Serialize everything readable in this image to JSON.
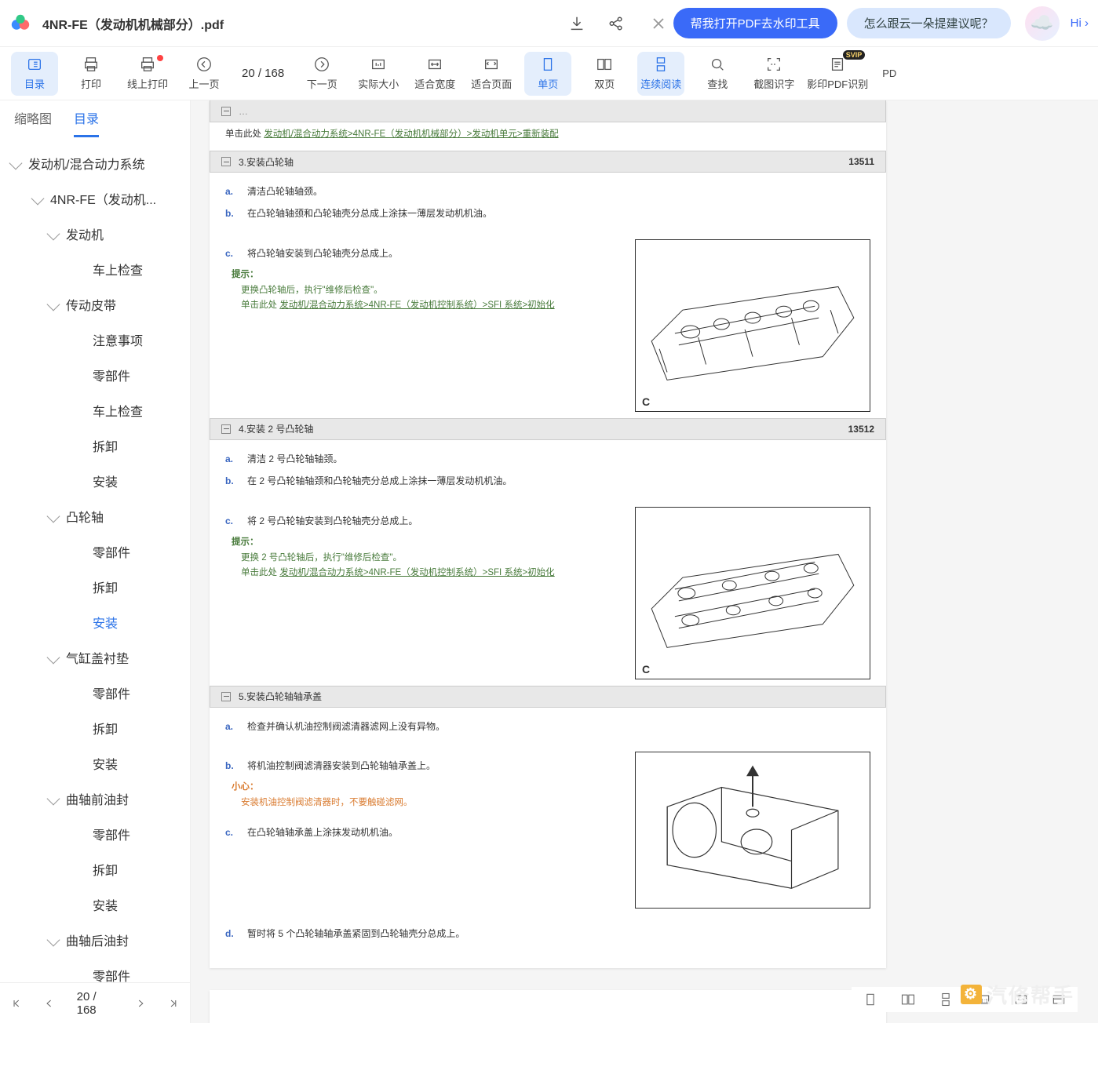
{
  "header": {
    "filename": "4NR-FE（发动机机械部分）.pdf",
    "hi": "Hi ›",
    "pill_help": "帮我打开PDF去水印工具",
    "pill_suggest": "怎么跟云一朵提建议呢？"
  },
  "toolbar": {
    "page_indicator": "20 / 168",
    "items": [
      {
        "id": "toc",
        "label": "目录"
      },
      {
        "id": "print",
        "label": "打印"
      },
      {
        "id": "cloud-print",
        "label": "线上打印"
      },
      {
        "id": "prev",
        "label": "上一页"
      },
      {
        "id": "next",
        "label": "下一页"
      },
      {
        "id": "actual",
        "label": "实际大小"
      },
      {
        "id": "fit-w",
        "label": "适合宽度"
      },
      {
        "id": "fit-p",
        "label": "适合页面"
      },
      {
        "id": "single",
        "label": "单页"
      },
      {
        "id": "double",
        "label": "双页"
      },
      {
        "id": "cont",
        "label": "连续阅读"
      },
      {
        "id": "search",
        "label": "查找"
      },
      {
        "id": "ocr-img",
        "label": "截图识字"
      },
      {
        "id": "ocr-pdf",
        "label": "影印PDF识别"
      },
      {
        "id": "pdf",
        "label": "PD"
      }
    ]
  },
  "sidebar": {
    "tabs": {
      "thumb": "缩略图",
      "toc": "目录"
    },
    "pagenum": "20 / 168",
    "nodes": [
      {
        "d": 0,
        "ar": 1,
        "t": "发动机/混合动力系统"
      },
      {
        "d": 1,
        "ar": 1,
        "t": "4NR-FE（发动机..."
      },
      {
        "d": 2,
        "ar": 1,
        "t": "发动机"
      },
      {
        "d": 3,
        "ar": 0,
        "t": "车上检查"
      },
      {
        "d": 2,
        "ar": 1,
        "t": "传动皮带"
      },
      {
        "d": 3,
        "ar": 0,
        "t": "注意事项"
      },
      {
        "d": 3,
        "ar": 0,
        "t": "零部件"
      },
      {
        "d": 3,
        "ar": 0,
        "t": "车上检查"
      },
      {
        "d": 3,
        "ar": 0,
        "t": "拆卸"
      },
      {
        "d": 3,
        "ar": 0,
        "t": "安装"
      },
      {
        "d": 2,
        "ar": 1,
        "t": "凸轮轴"
      },
      {
        "d": 3,
        "ar": 0,
        "t": "零部件"
      },
      {
        "d": 3,
        "ar": 0,
        "t": "拆卸"
      },
      {
        "d": 3,
        "ar": 0,
        "t": "安装",
        "sel": 1
      },
      {
        "d": 2,
        "ar": 1,
        "t": "气缸盖衬垫"
      },
      {
        "d": 3,
        "ar": 0,
        "t": "零部件"
      },
      {
        "d": 3,
        "ar": 0,
        "t": "拆卸"
      },
      {
        "d": 3,
        "ar": 0,
        "t": "安装"
      },
      {
        "d": 2,
        "ar": 1,
        "t": "曲轴前油封"
      },
      {
        "d": 3,
        "ar": 0,
        "t": "零部件"
      },
      {
        "d": 3,
        "ar": 0,
        "t": "拆卸"
      },
      {
        "d": 3,
        "ar": 0,
        "t": "安装"
      },
      {
        "d": 2,
        "ar": 1,
        "t": "曲轴后油封"
      },
      {
        "d": 3,
        "ar": 0,
        "t": "零部件"
      }
    ]
  },
  "doc": {
    "crumb_prefix": "单击此处 ",
    "crumb": "发动机/混合动力系统>4NR-FE（发动机机械部分）>发动机单元>重新装配",
    "sec3": {
      "title": "3.安装凸轮轴",
      "code": "13511",
      "a": "清洁凸轮轴轴颈。",
      "b": "在凸轮轴轴颈和凸轮轴壳分总成上涂抹一薄层发动机机油。",
      "c": "将凸轮轴安装到凸轮轴壳分总成上。",
      "hint1": "提示：",
      "hint2": "更换凸轮轴后，执行\"维修后检查\"。",
      "hint3_pre": "单击此处 ",
      "hint3": "发动机/混合动力系统>4NR-FE（发动机控制系统）>SFI 系统>初始化"
    },
    "sec4": {
      "title": "4.安装 2 号凸轮轴",
      "code": "13512",
      "a": "清洁 2 号凸轮轴轴颈。",
      "b": "在 2 号凸轮轴轴颈和凸轮轴壳分总成上涂抹一薄层发动机机油。",
      "c": "将 2 号凸轮轴安装到凸轮轴壳分总成上。",
      "hint1": "提示：",
      "hint2": "更换 2 号凸轮轴后，执行\"维修后检查\"。",
      "hint3_pre": "单击此处 ",
      "hint3": "发动机/混合动力系统>4NR-FE（发动机控制系统）>SFI 系统>初始化"
    },
    "sec5": {
      "title": "5.安装凸轮轴轴承盖",
      "a": "检查并确认机油控制阀滤清器滤网上没有异物。",
      "b": "将机油控制阀滤清器安装到凸轮轴轴承盖上。",
      "warn1": "小心：",
      "warn2": "安装机油控制阀滤清器时，不要触碰滤网。",
      "c": "在凸轮轴轴承盖上涂抹发动机机油。",
      "d": "暂时将 5 个凸轮轴轴承盖紧固到凸轮轴壳分总成上。"
    },
    "figC": "C",
    "watermark": "汽修帮手"
  }
}
